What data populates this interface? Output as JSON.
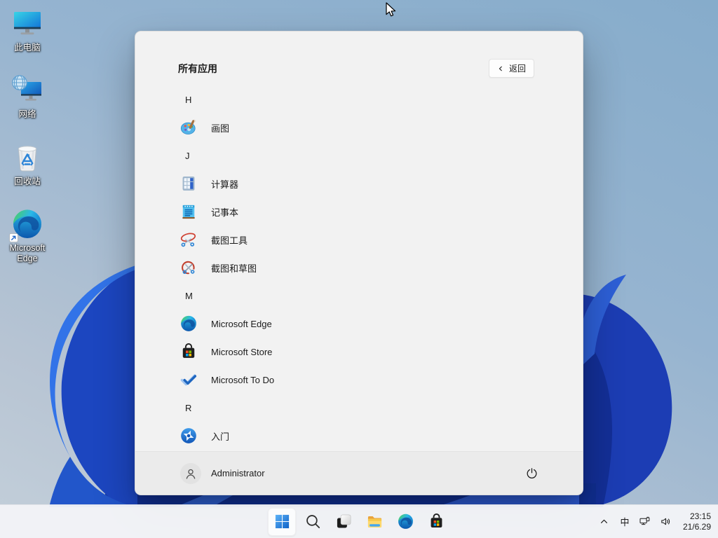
{
  "desktop": {
    "icons": [
      {
        "id": "this-pc",
        "label": "此电脑",
        "icon": "this-pc-icon"
      },
      {
        "id": "network",
        "label": "网络",
        "icon": "network-icon"
      },
      {
        "id": "recycle-bin",
        "label": "回收站",
        "icon": "recycle-bin-icon"
      },
      {
        "id": "microsoft-edge",
        "label": "Microsoft Edge",
        "icon": "edge-icon",
        "shortcut": true
      }
    ]
  },
  "start_menu": {
    "title": "所有应用",
    "back_label": "返回",
    "items": [
      {
        "type": "section",
        "label": "H"
      },
      {
        "type": "app",
        "id": "paint",
        "label": "画图",
        "icon": "paint-icon"
      },
      {
        "type": "section",
        "label": "J"
      },
      {
        "type": "app",
        "id": "calculator",
        "label": "计算器",
        "icon": "calculator-icon"
      },
      {
        "type": "app",
        "id": "notepad",
        "label": "记事本",
        "icon": "notepad-icon"
      },
      {
        "type": "app",
        "id": "snipping-tool",
        "label": "截图工具",
        "icon": "snipping-tool-icon"
      },
      {
        "type": "app",
        "id": "snip-sketch",
        "label": "截图和草图",
        "icon": "snip-sketch-icon"
      },
      {
        "type": "section",
        "label": "M"
      },
      {
        "type": "app",
        "id": "microsoft-edge",
        "label": "Microsoft Edge",
        "icon": "edge-icon"
      },
      {
        "type": "app",
        "id": "microsoft-store",
        "label": "Microsoft Store",
        "icon": "store-icon"
      },
      {
        "type": "app",
        "id": "microsoft-to-do",
        "label": "Microsoft To Do",
        "icon": "todo-icon"
      },
      {
        "type": "section",
        "label": "R"
      },
      {
        "type": "app",
        "id": "get-started",
        "label": "入门",
        "icon": "get-started-icon"
      }
    ],
    "user": {
      "name": "Administrator"
    }
  },
  "taskbar": {
    "buttons": [
      {
        "name": "start",
        "icon": "windows-start-icon",
        "active": true
      },
      {
        "name": "search",
        "icon": "search-icon",
        "active": false
      },
      {
        "name": "task-view",
        "icon": "task-view-icon",
        "active": false
      },
      {
        "name": "file-explorer",
        "icon": "folder-icon",
        "active": false
      },
      {
        "name": "edge",
        "icon": "edge-icon",
        "active": false
      },
      {
        "name": "store",
        "icon": "store-icon",
        "active": false
      }
    ],
    "tray": {
      "ime": "中",
      "time": "23:15",
      "date": "21/6.29"
    }
  },
  "colors": {
    "accent": "#1f7ae0",
    "bloom_dark": "#1c3db4",
    "bloom_light": "#3273e8",
    "menu_bg": "#f2f2f2",
    "taskbar_bg": "#f2f4f7"
  }
}
